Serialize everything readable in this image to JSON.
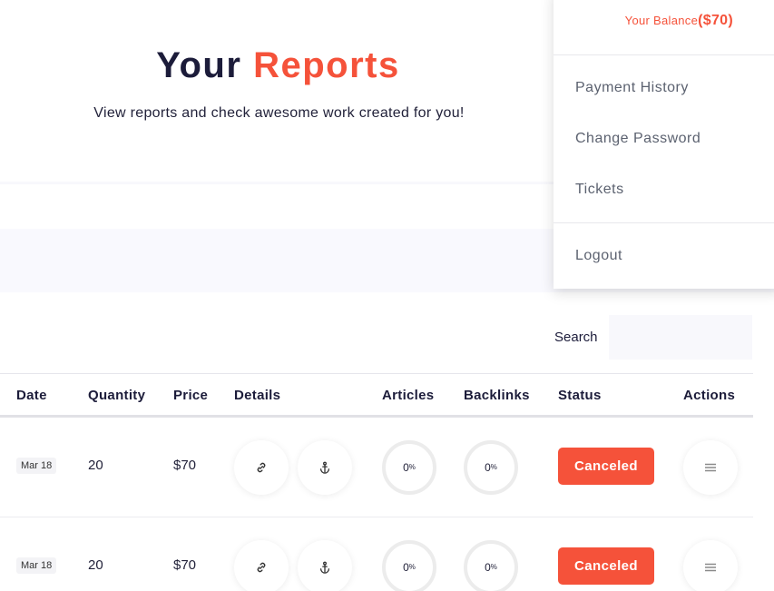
{
  "hero": {
    "title_main": "Your",
    "title_accent": "Reports",
    "subtitle": "View reports and check awesome work created for you!"
  },
  "search": {
    "label": "Search",
    "value": ""
  },
  "table": {
    "headers": [
      "Date",
      "Quantity",
      "Price",
      "Details",
      "Articles",
      "Backlinks",
      "Status",
      "Actions"
    ],
    "rows": [
      {
        "date": "Mar 18",
        "quantity": "20",
        "price": "$70",
        "articles": "0",
        "articles_unit": "%",
        "backlinks": "0",
        "backlinks_unit": "%",
        "status": "Canceled"
      },
      {
        "date": "Mar 18",
        "quantity": "20",
        "price": "$70",
        "articles": "0",
        "articles_unit": "%",
        "backlinks": "0",
        "backlinks_unit": "%",
        "status": "Canceled"
      }
    ],
    "icons": {
      "details_1": "link-icon",
      "details_2": "anchor-icon",
      "actions": "hamburger-menu-icon"
    }
  },
  "dropdown": {
    "balance_label": "Your Balance",
    "balance_value": "($70)",
    "items": [
      "Payment History",
      "Change Password",
      "Tickets"
    ],
    "logout": "Logout"
  },
  "colors": {
    "accent": "#f5523a",
    "heading": "#1c1c3a",
    "menu_text": "#5c6270"
  }
}
